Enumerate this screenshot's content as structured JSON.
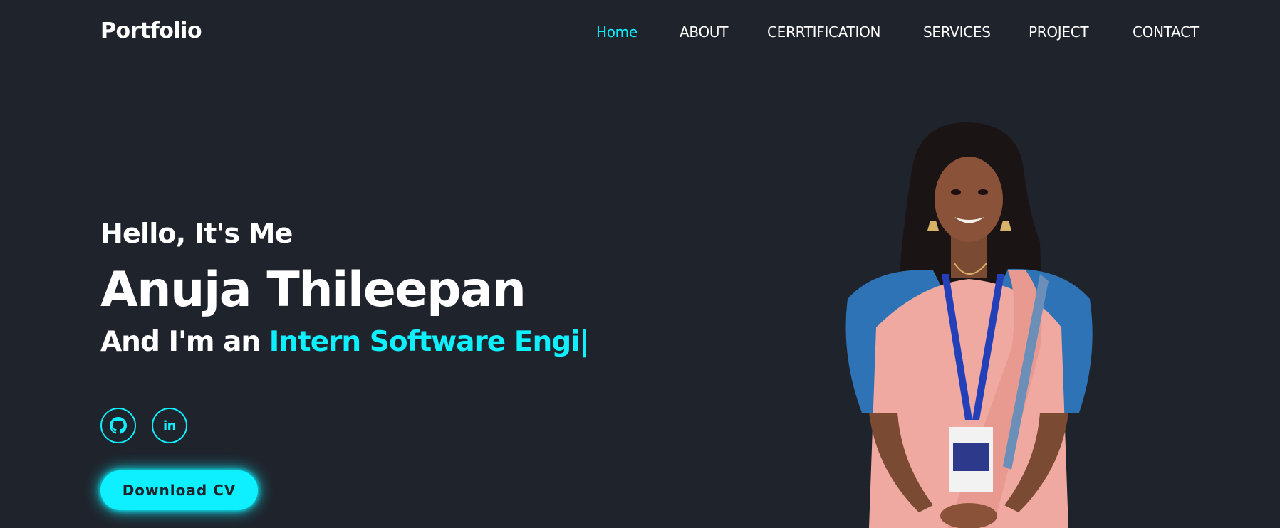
{
  "header": {
    "logo": "Portfolio",
    "nav": [
      "Home",
      "ABOUT",
      "CERRTIFICATION",
      "SERVICES",
      "PROJECT",
      "CONTACT"
    ]
  },
  "hero": {
    "greeting": "Hello, It's Me",
    "name": "Anuja Thileepan",
    "role_prefix": "And I'm an ",
    "role_typed": "Intern Software Engi",
    "caret": "|",
    "cta": "Download CV"
  },
  "social": [
    {
      "icon": "github-icon"
    },
    {
      "icon": "linkedin-icon",
      "label": "in"
    }
  ],
  "colors": {
    "background": "#1f232c",
    "accent": "#0ef0ff",
    "text": "#ffffff"
  }
}
